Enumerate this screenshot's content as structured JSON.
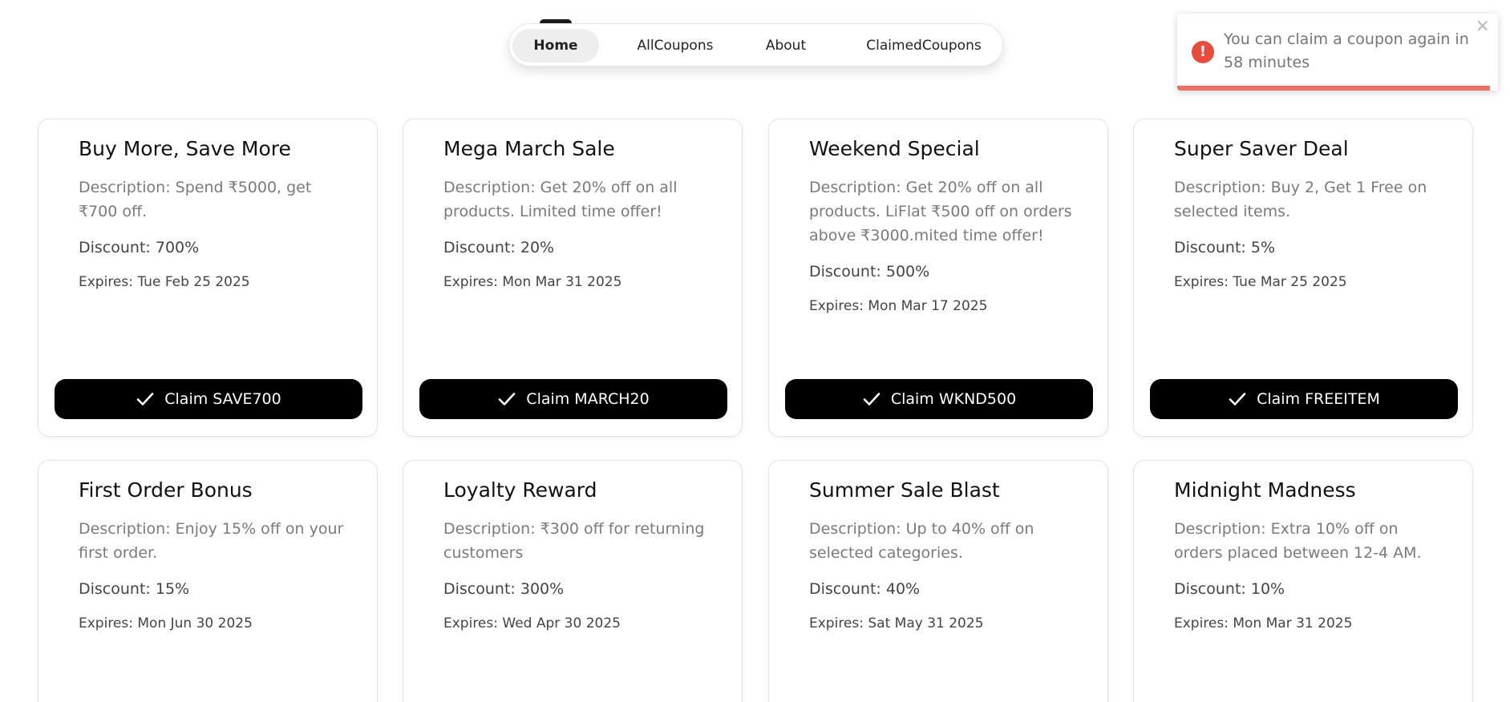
{
  "nav": {
    "items": [
      {
        "label": "Home",
        "active": true
      },
      {
        "label": "AllCoupons",
        "active": false
      },
      {
        "label": "About",
        "active": false
      },
      {
        "label": "ClaimedCoupons",
        "active": false
      }
    ]
  },
  "toast": {
    "icon": "exclamation-icon",
    "message": "You can claim a coupon again in 58 minutes",
    "close_label": "×",
    "status_color": "#e74c3c"
  },
  "coupons": [
    {
      "title": "Buy More, Save More",
      "description": "Description: Spend ₹5000, get ₹700 off.",
      "discount": "Discount: 700%",
      "expires": "Expires: Tue Feb 25 2025",
      "claim_label": "Claim SAVE700"
    },
    {
      "title": "Mega March Sale",
      "description": "Description: Get 20% off on all products. Limited time offer!",
      "discount": "Discount: 20%",
      "expires": "Expires: Mon Mar 31 2025",
      "claim_label": "Claim MARCH20"
    },
    {
      "title": "Weekend Special",
      "description": "Description: Get 20% off on all products. LiFlat ₹500 off on orders above ₹3000.mited time offer!",
      "discount": "Discount: 500%",
      "expires": "Expires: Mon Mar 17 2025",
      "claim_label": "Claim WKND500"
    },
    {
      "title": "Super Saver Deal",
      "description": "Description: Buy 2, Get 1 Free on selected items.",
      "discount": "Discount: 5%",
      "expires": "Expires: Tue Mar 25 2025",
      "claim_label": "Claim FREEITEM"
    },
    {
      "title": "First Order Bonus",
      "description": "Description: Enjoy 15% off on your first order.",
      "discount": "Discount: 15%",
      "expires": "Expires: Mon Jun 30 2025"
    },
    {
      "title": "Loyalty Reward",
      "description": "Description: ₹300 off for returning customers",
      "discount": "Discount: 300%",
      "expires": "Expires: Wed Apr 30 2025"
    },
    {
      "title": "Summer Sale Blast",
      "description": "Description: Up to 40% off on selected categories.",
      "discount": "Discount: 40%",
      "expires": "Expires: Sat May 31 2025"
    },
    {
      "title": "Midnight Madness",
      "description": "Description: Extra 10% off on orders placed between 12-4 AM.",
      "discount": "Discount: 10%",
      "expires": "Expires: Mon Mar 31 2025"
    }
  ],
  "colors": {
    "button_bg": "#000000",
    "button_text": "#ffffff",
    "description_text": "#7a7a7a",
    "nav_active_bg": "#eeeeee"
  }
}
